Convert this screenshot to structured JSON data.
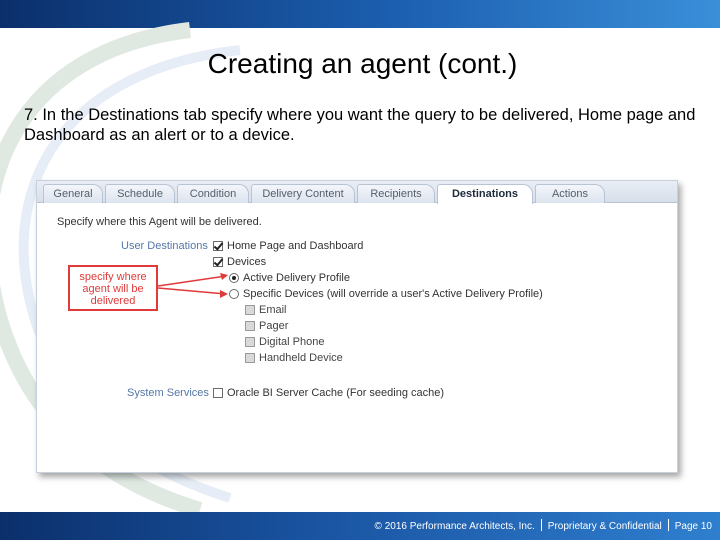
{
  "slide": {
    "title": "Creating an agent (cont.)",
    "body": "7. In the Destinations tab specify where you want the query to be delivered, Home page and Dashboard as an alert or to a device.",
    "footer": {
      "copyright": "© 2016 Performance Architects, Inc.",
      "confidential": "Proprietary & Confidential",
      "page": "Page 10"
    }
  },
  "screenshot": {
    "tabs": [
      {
        "label": "General",
        "active": false
      },
      {
        "label": "Schedule",
        "active": false
      },
      {
        "label": "Condition",
        "active": false
      },
      {
        "label": "Delivery Content",
        "active": false
      },
      {
        "label": "Recipients",
        "active": false
      },
      {
        "label": "Destinations",
        "active": true
      },
      {
        "label": "Actions",
        "active": false
      }
    ],
    "instruction": "Specify where this Agent will be delivered.",
    "user_destinations": {
      "section_label": "User Destinations",
      "home_page_dashboard": {
        "label": "Home Page and Dashboard",
        "checked": true
      },
      "devices": {
        "label": "Devices",
        "checked": true
      },
      "active_delivery_profile": {
        "label": "Active Delivery Profile",
        "selected": true
      },
      "specific_devices": {
        "label": "Specific Devices (will override a user's Active Delivery Profile)",
        "selected": false
      },
      "device_options": [
        {
          "label": "Email",
          "checked": false
        },
        {
          "label": "Pager",
          "checked": false
        },
        {
          "label": "Digital Phone",
          "checked": false
        },
        {
          "label": "Handheld Device",
          "checked": false
        }
      ]
    },
    "system_services": {
      "section_label": "System Services",
      "server_cache": {
        "label": "Oracle BI Server Cache (For seeding cache)",
        "checked": false
      }
    },
    "callout": {
      "line1": "specify where",
      "line2": "agent will be",
      "line3": "delivered"
    },
    "colors": {
      "callout": "#e03a3a",
      "section_label": "#5577a9",
      "header_bar": "#1c5fb0"
    }
  }
}
